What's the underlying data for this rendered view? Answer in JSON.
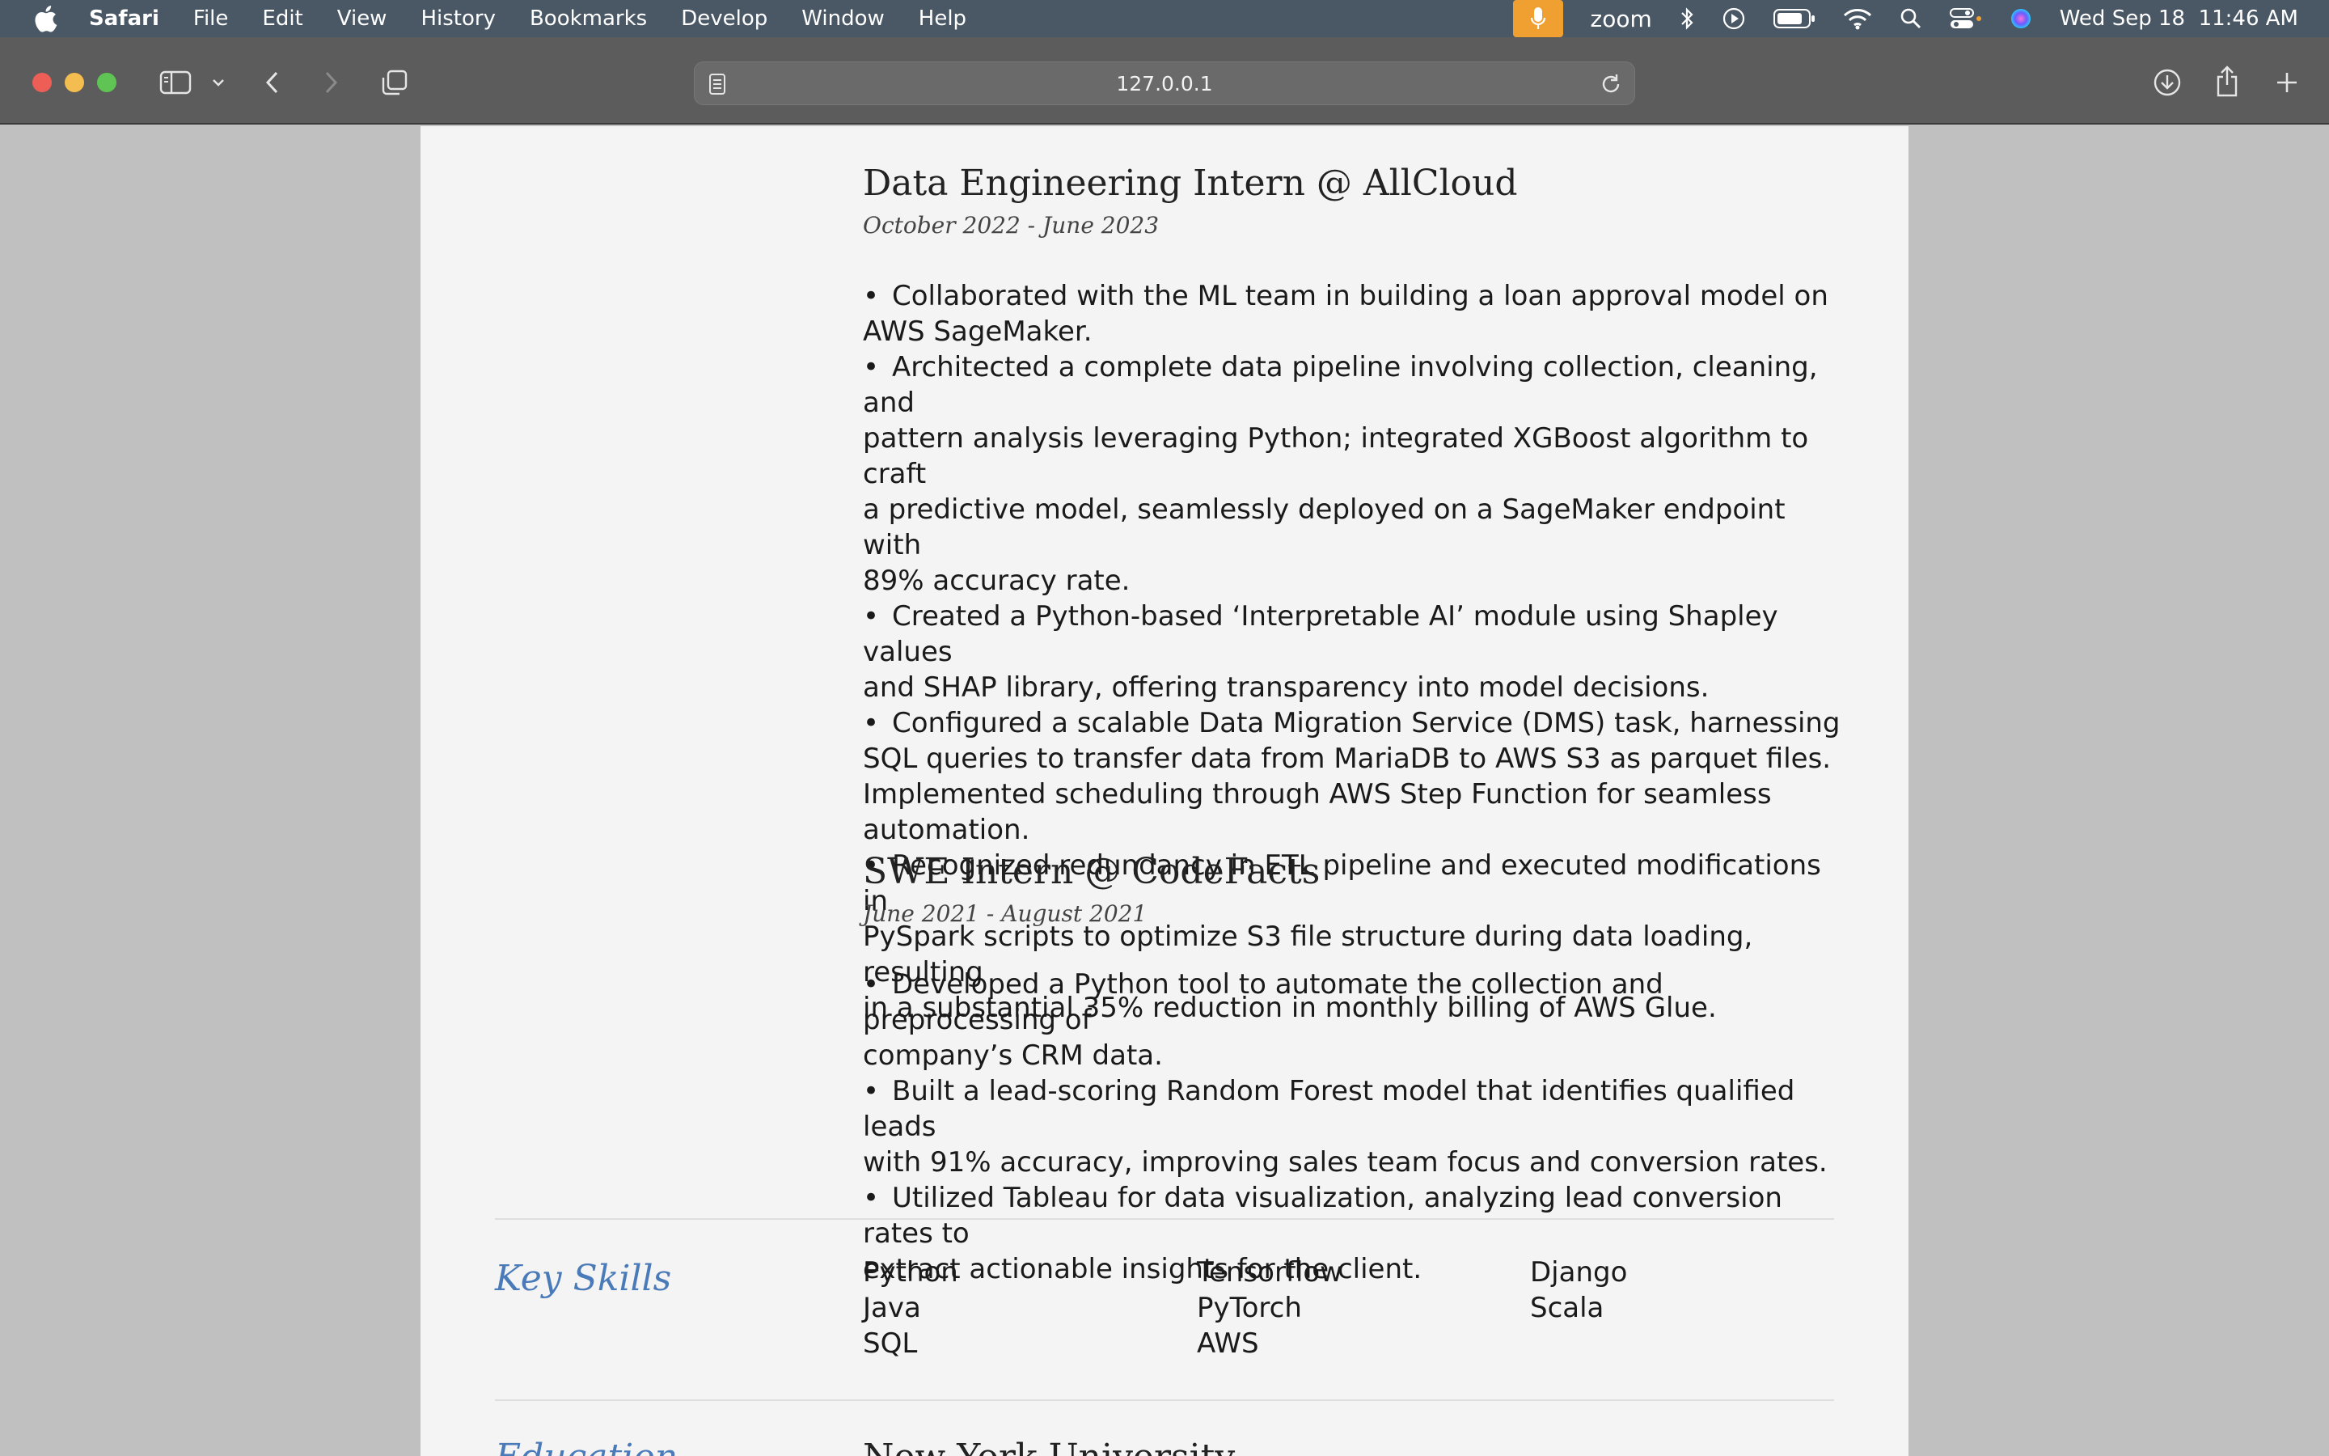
{
  "menubar": {
    "app_name": "Safari",
    "items": [
      "File",
      "Edit",
      "View",
      "History",
      "Bookmarks",
      "Develop",
      "Window",
      "Help"
    ],
    "zoom_label": "zoom",
    "datetime": "Wed Sep 18  11:46 AM"
  },
  "browser": {
    "url": "127.0.0.1"
  },
  "resume": {
    "jobs": [
      {
        "title": "Data Engineering Intern @ AllCloud",
        "dates": "October 2022 - June 2023",
        "bullets": [
          [
            "Collaborated with the ML team in building a loan approval model on",
            "AWS SageMaker."
          ],
          [
            "Architected a complete data pipeline involving collection, cleaning, and",
            "pattern analysis leveraging Python; integrated XGBoost algorithm to craft",
            "a predictive model, seamlessly deployed on a SageMaker endpoint with",
            "89% accuracy rate."
          ],
          [
            "Created a Python-based ‘Interpretable AI’ module using Shapley values",
            "and SHAP library, offering transparency into model decisions."
          ],
          [
            "Configured a scalable Data Migration Service (DMS) task, harnessing",
            "SQL queries to transfer data from MariaDB to AWS S3 as parquet files.",
            "Implemented scheduling through AWS Step Function for seamless",
            "automation."
          ],
          [
            "Recognized redundancy in ETL pipeline and executed modifications in",
            "PySpark scripts to optimize S3 file structure during data loading, resulting",
            "in a substantial 35% reduction in monthly billing of AWS Glue."
          ]
        ]
      },
      {
        "title": "SWE Intern @ CodeFacts",
        "dates": "June 2021 - August 2021",
        "bullets": [
          [
            "Developed a Python tool to automate the collection and preprocessing of",
            "company’s CRM data."
          ],
          [
            "Built a lead-scoring Random Forest model that identifies qualified leads",
            "with 91% accuracy, improving sales team focus and conversion rates."
          ],
          [
            "Utilized Tableau for data visualization, analyzing lead conversion rates to",
            "extract actionable insights for the client."
          ]
        ]
      }
    ],
    "skills": {
      "title": "Key Skills",
      "columns": [
        [
          "Python",
          "Java",
          "SQL"
        ],
        [
          "Tensorflow",
          "PyTorch",
          "AWS"
        ],
        [
          "Django",
          "Scala"
        ]
      ]
    },
    "education": {
      "title": "Education",
      "school": "New York University"
    }
  },
  "colors": {
    "accent": "#4a7ab8",
    "menubar_bg": "#4a5866",
    "toolbar_bg": "#5c5c5c",
    "page_bg": "#f4f4f4",
    "side_bg": "#c0c0c0"
  }
}
